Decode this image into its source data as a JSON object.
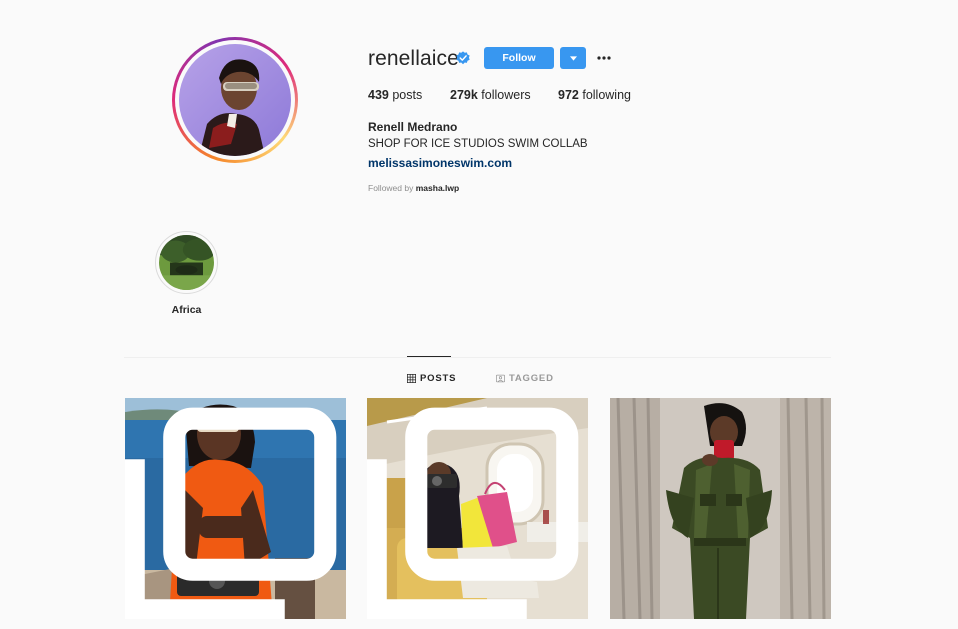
{
  "profile": {
    "username": "renellaice",
    "verified": true,
    "follow_label": "Follow",
    "full_name": "Renell Medrano",
    "bio": "SHOP FOR ICE STUDIOS SWIM COLLAB",
    "website": "melissasimoneswim.com",
    "followed_by_prefix": "Followed by",
    "followed_by_user": "masha.lwp"
  },
  "stats": {
    "posts_count": "439",
    "posts_label": "posts",
    "followers_count": "279k",
    "followers_label": "followers",
    "following_count": "972",
    "following_label": "following"
  },
  "highlights": [
    {
      "label": "Africa"
    }
  ],
  "tabs": {
    "posts": "POSTS",
    "tagged": "TAGGED"
  },
  "colors": {
    "accent": "#3897f0",
    "link": "#003569",
    "background": "#fafafa",
    "muted": "#8e8e8e"
  },
  "icons": {
    "verified": "verified-badge-icon",
    "dropdown": "chevron-down-icon",
    "more": "more-options-icon",
    "posts_tab": "grid-icon",
    "tagged_tab": "tag-icon",
    "multi_post": "carousel-icon"
  }
}
